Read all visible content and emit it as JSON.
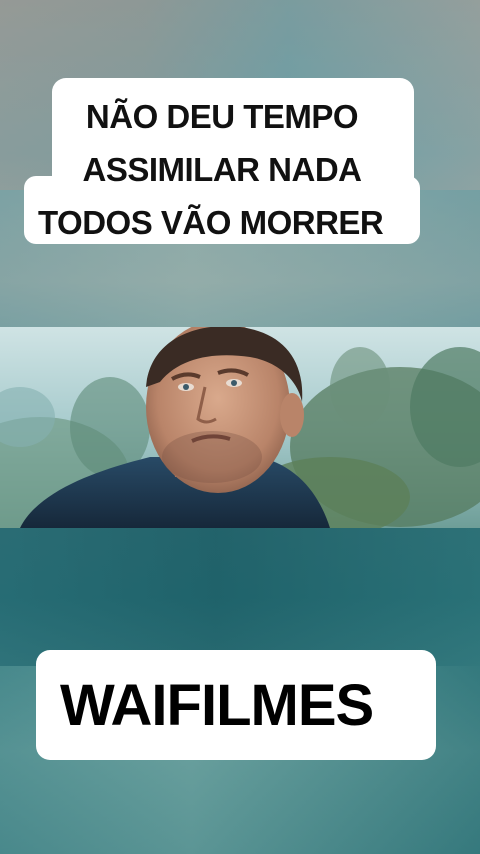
{
  "caption": {
    "lines": [
      "NÃO DEU TEMPO",
      "ASSIMILAR NADA",
      "TODOS VÃO MORRER"
    ]
  },
  "scene": {
    "description_icon": "movie-still-image"
  },
  "watermark": {
    "label": "WAIFILMES"
  },
  "colors": {
    "caption_bg": "#ffffff",
    "caption_text": "#111111",
    "brand_text": "#000000",
    "background_accent": "#2b6b73"
  }
}
